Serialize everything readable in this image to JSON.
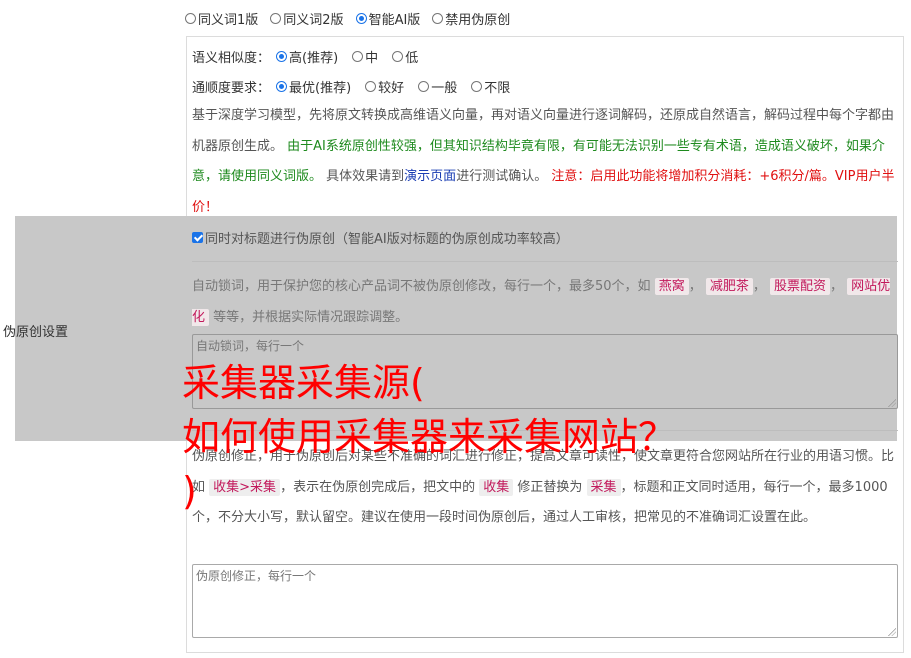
{
  "mode_options": [
    {
      "label": "同义词1版",
      "selected": false
    },
    {
      "label": "同义词2版",
      "selected": false
    },
    {
      "label": "智能AI版",
      "selected": true
    },
    {
      "label": "禁用伪原创",
      "selected": false
    }
  ],
  "similarity": {
    "label": "语义相似度：",
    "options": [
      {
        "label": "高(推荐)",
        "selected": true
      },
      {
        "label": "中",
        "selected": false
      },
      {
        "label": "低",
        "selected": false
      }
    ]
  },
  "fluency": {
    "label": "通顺度要求：",
    "options": [
      {
        "label": "最优(推荐)",
        "selected": true
      },
      {
        "label": "较好",
        "selected": false
      },
      {
        "label": "一般",
        "selected": false
      },
      {
        "label": "不限",
        "selected": false
      }
    ]
  },
  "description": {
    "part1": "基于深度学习模型，先将原文转换成高维语义向量，再对语义向量进行逐词解码，还原成自然语言，解码过程中每个字都由机器原创生成。",
    "part2_green": "由于AI系统原创性较强，但其知识结构毕竟有限，有可能无法识别一些专有术语，造成语义破坏，如果介意，请使用同义词版。",
    "part3": "具体效果请到",
    "demo_link": "演示页面",
    "part4": "进行测试确认。",
    "part5_red": "注意：启用此功能将增加积分消耗：+6积分/篇。VIP用户半价！"
  },
  "sidebar_label": "伪原创设置",
  "title_check": {
    "label": "同时对标题进行伪原创（智能AI版对标题的伪原创成功率较高）",
    "checked": true
  },
  "lock_words": {
    "desc_pre": "自动锁词，用于保护您的核心产品词不被伪原创修改，每行一个，最多50个，如",
    "tags": [
      "燕窝",
      "减肥茶",
      "股票配资",
      "网站优化"
    ],
    "desc_post": "等等，并根据实际情况跟踪调整。",
    "placeholder": "自动锁词，每行一个"
  },
  "correction": {
    "desc_pre": "伪原创修正，用于伪原创后对某些不准确的词汇进行修正，提高文章可读性，使文章更符合您网站所在行业的用语习惯。比如",
    "tag1": "收集>采集",
    "desc_mid": "，表示在伪原创完成后，把文中的",
    "tag2": "收集",
    "desc_mid2": "修正替换为",
    "tag3": "采集",
    "desc_post": "，标题和正文同时适用，每行一个，最多1000个，不分大小写，默认留空。建议在使用一段时间伪原创后，通过人工审核，把常见的不准确词汇设置在此。",
    "placeholder": "伪原创修正，每行一个"
  },
  "watermark": {
    "line1": "采集器采集源(",
    "line2": "如何使用采集器来采集网站？",
    "line3": ")"
  },
  "colors": {
    "accent": "#1a73e8",
    "green": "#1e8a1e",
    "red": "#e01010",
    "link": "#1a3db3",
    "overlay": "#c8c8c8",
    "tag_text": "#c2185b"
  }
}
